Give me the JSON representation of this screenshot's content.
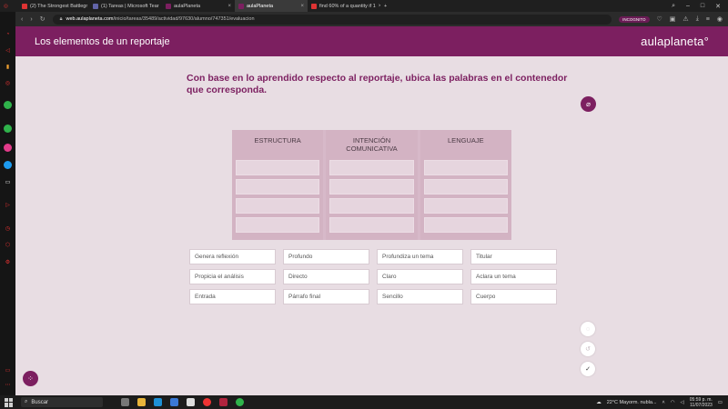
{
  "browser": {
    "tabs": [
      {
        "title": "(2) The Strongest Battlegr",
        "color": "#d33"
      },
      {
        "title": "(1) Tareas | Microsoft Tear",
        "color": "#6264a7"
      },
      {
        "title": "aulaPlaneta",
        "color": "#7c1f60"
      },
      {
        "title": "aulaPlaneta",
        "color": "#7c1f60"
      },
      {
        "title": "find 60% of a quantity if 1",
        "color": "#d33"
      }
    ],
    "url_host": "web.aulaplaneta.com",
    "url_path": "/inicio/tareas/35489/actividad/97630/alumno/747351/evaluacion",
    "profile_badge": "INCOGNITO"
  },
  "app": {
    "title": "Los elementos de un reportaje",
    "logo": "aulaplaneta°"
  },
  "activity": {
    "question": "Con base en lo aprendido respecto al reportaje, ubica las palabras en el contenedor que corresponda.",
    "columns": [
      {
        "label": "ESTRUCTURA"
      },
      {
        "label": "INTENCIÓN COMUNICATIVA"
      },
      {
        "label": "LENGUAJE"
      }
    ],
    "words": [
      "Genera reflexión",
      "Profundo",
      "Profundiza un tema",
      "Titular",
      "Propicia el análisis",
      "Directo",
      "Claro",
      "Aclara un tema",
      "Entrada",
      "Párrafo final",
      "Sencillo",
      "Cuerpo"
    ]
  },
  "taskbar": {
    "search": "Buscar",
    "weather": "22°C  Mayorm. nubla...",
    "time": "05:59 p. m.",
    "date": "11/07/2023"
  },
  "colors": {
    "brand": "#7c1f60",
    "page_bg": "#e8dde3"
  }
}
